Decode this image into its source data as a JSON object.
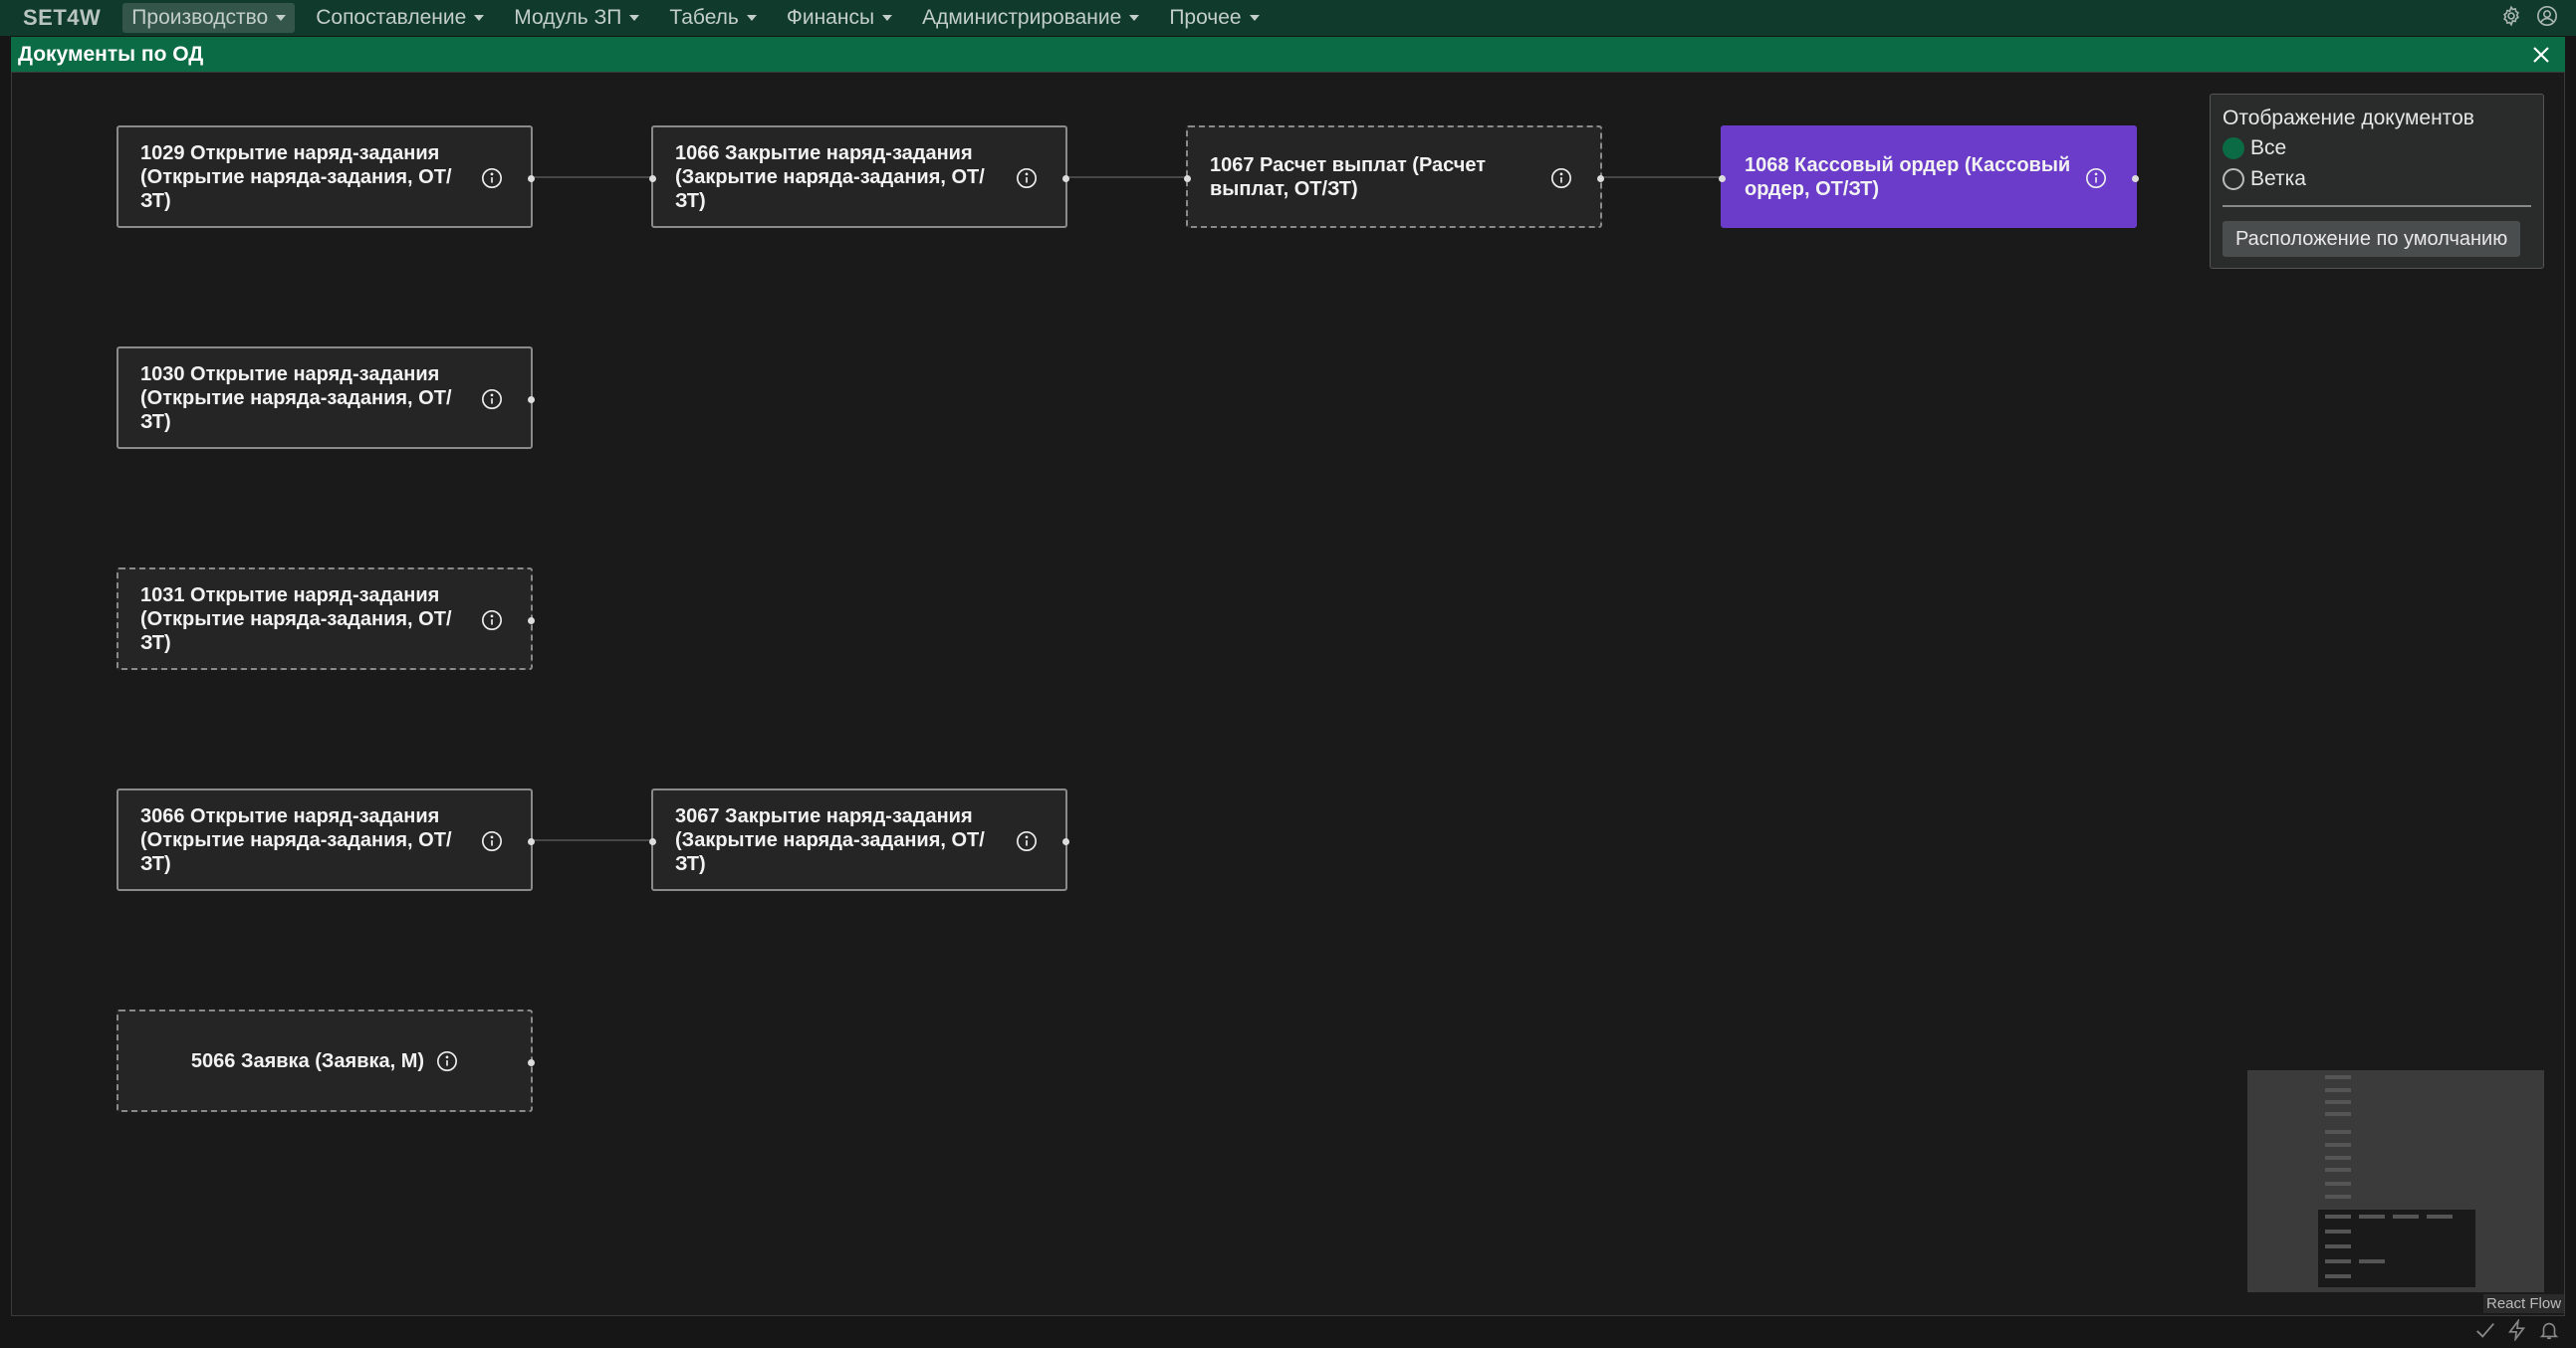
{
  "app": {
    "brand": "SET4W",
    "menu": [
      {
        "label": "Производство",
        "active": true
      },
      {
        "label": "Сопоставление",
        "active": false
      },
      {
        "label": "Модуль ЗП",
        "active": false
      },
      {
        "label": "Табель",
        "active": false
      },
      {
        "label": "Финансы",
        "active": false
      },
      {
        "label": "Администрирование",
        "active": false
      },
      {
        "label": "Прочее",
        "active": false
      }
    ],
    "nav_icons": [
      "gear-icon",
      "user-circle-icon"
    ]
  },
  "modal": {
    "title": "Документы по ОД",
    "close_icon": "close-icon"
  },
  "nodes": [
    {
      "id": "1029",
      "label": "1029 Открытие наряд-задания (Открытие наряда-задания, ОТ/ЗТ)",
      "style": "solid"
    },
    {
      "id": "1066",
      "label": "1066 Закрытие наряд-задания (Закрытие наряда-задания, ОТ/ЗТ)",
      "style": "solid"
    },
    {
      "id": "1067",
      "label": "1067 Расчет выплат (Расчет выплат, ОТ/ЗТ)",
      "style": "dashed"
    },
    {
      "id": "1068",
      "label": "1068 Кассовый ордер (Кассовый ордер, ОТ/ЗТ)",
      "style": "selected"
    },
    {
      "id": "1030",
      "label": "1030 Открытие наряд-задания (Открытие наряда-задания, ОТ/ЗТ)",
      "style": "solid"
    },
    {
      "id": "1031",
      "label": "1031 Открытие наряд-задания (Открытие наряда-задания, ОТ/ЗТ)",
      "style": "dashed"
    },
    {
      "id": "3066",
      "label": "3066 Открытие наряд-задания (Открытие наряда-задания, ОТ/ЗТ)",
      "style": "solid"
    },
    {
      "id": "3067",
      "label": "3067 Закрытие наряд-задания (Закрытие наряда-задания, ОТ/ЗТ)",
      "style": "solid"
    },
    {
      "id": "5066",
      "label": "5066 Заявка (Заявка, М)",
      "style": "dashed"
    }
  ],
  "edges": [
    [
      "1029",
      "1066"
    ],
    [
      "1066",
      "1067"
    ],
    [
      "1067",
      "1068"
    ],
    [
      "3066",
      "3067"
    ]
  ],
  "panel": {
    "title": "Отображение документов",
    "options": [
      {
        "label": "Все",
        "selected": true
      },
      {
        "label": "Ветка",
        "selected": false
      }
    ],
    "reset_button": "Расположение по умолчанию"
  },
  "minimap": {
    "attribution": "React Flow"
  },
  "colors": {
    "nav_bg": "#0f3a2c",
    "modal_header": "#0b6b45",
    "selected_node": "#6a3cc9"
  }
}
